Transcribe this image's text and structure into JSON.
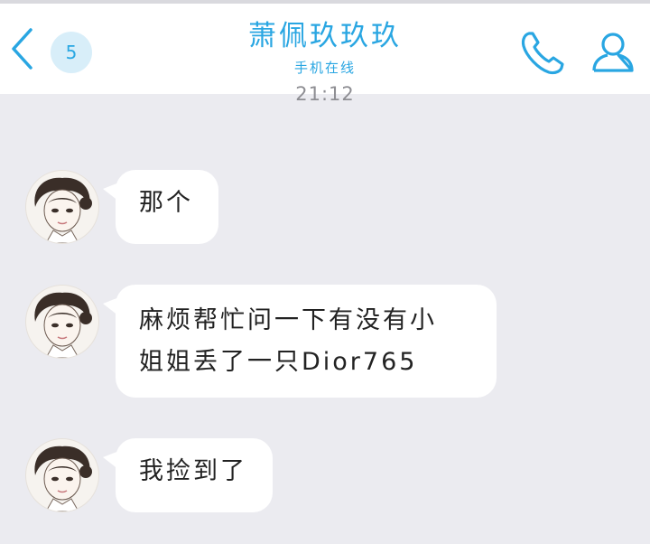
{
  "header": {
    "unread_count": "5",
    "contact_name": "萧佩玖玖玖",
    "status": "手机在线"
  },
  "timestamp": "21:12",
  "messages": [
    {
      "text": "那个"
    },
    {
      "line1": "麻烦帮忙问一下有没有小",
      "line2": "姐姐丢了一只Dior765"
    },
    {
      "text": "我捡到了"
    }
  ],
  "colors": {
    "accent": "#29a6e2",
    "background": "#ebebf0",
    "bubble": "#ffffff"
  },
  "icons": [
    "back-chevron-icon",
    "phone-icon",
    "profile-icon"
  ]
}
